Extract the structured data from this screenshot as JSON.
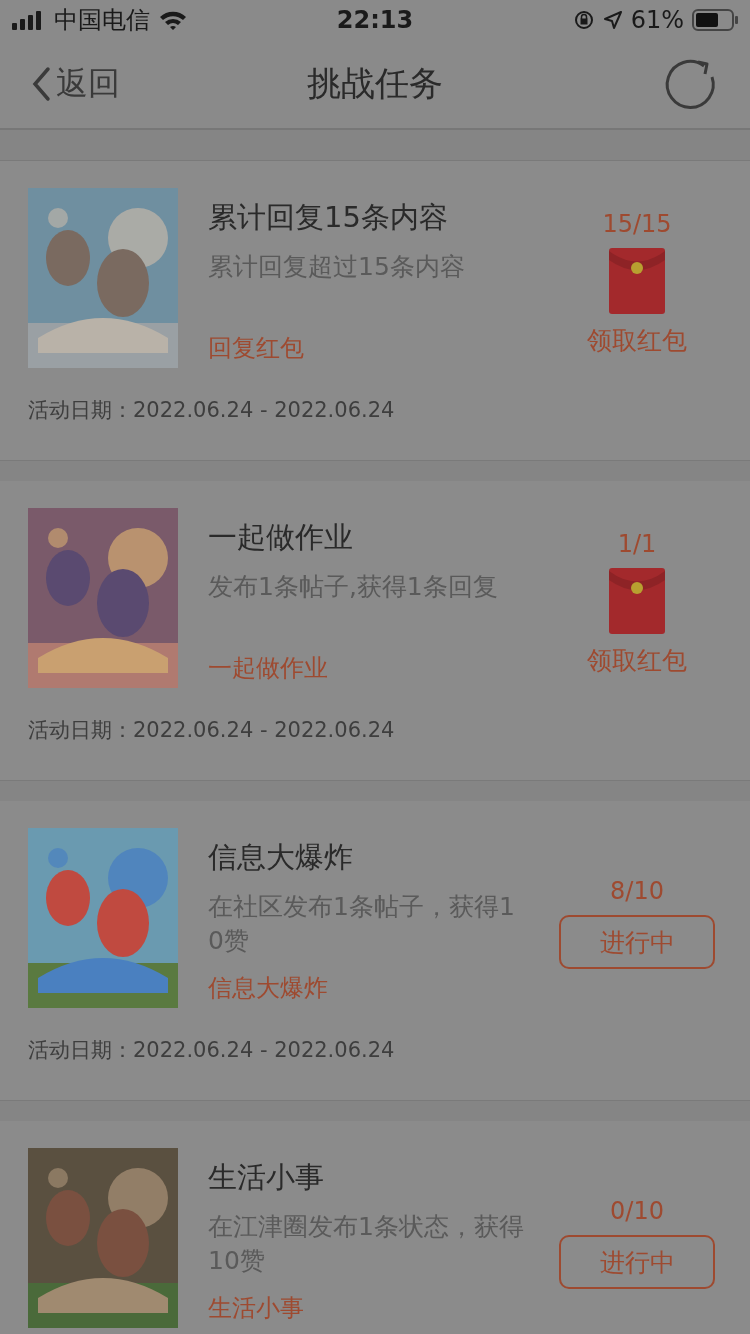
{
  "status_bar": {
    "carrier": "中国电信",
    "time": "22:13",
    "battery": "61%"
  },
  "nav": {
    "back": "返回",
    "title": "挑战任务"
  },
  "tasks": [
    {
      "title": "累计回复15条内容",
      "desc": "累计回复超过15条内容",
      "tag": "回复红包",
      "date": "活动日期：2022.06.24 - 2022.06.24",
      "progress": "15/15",
      "action": {
        "kind": "envelope",
        "label": "领取红包"
      }
    },
    {
      "title": "一起做作业",
      "desc": "发布1条帖子,获得1条回复",
      "tag": "一起做作业",
      "date": "活动日期：2022.06.24 - 2022.06.24",
      "progress": "1/1",
      "action": {
        "kind": "envelope",
        "label": "领取红包"
      }
    },
    {
      "title": "信息大爆炸",
      "desc": "在社区发布1条帖子，获得10赞",
      "tag": "信息大爆炸",
      "date": "活动日期：2022.06.24 - 2022.06.24",
      "progress": "8/10",
      "action": {
        "kind": "button",
        "label": "进行中"
      }
    },
    {
      "title": "生活小事",
      "desc": "在江津圈发布1条状态，获得10赞",
      "tag": "生活小事",
      "progress": "0/10",
      "action": {
        "kind": "button",
        "label": "进行中"
      }
    }
  ]
}
